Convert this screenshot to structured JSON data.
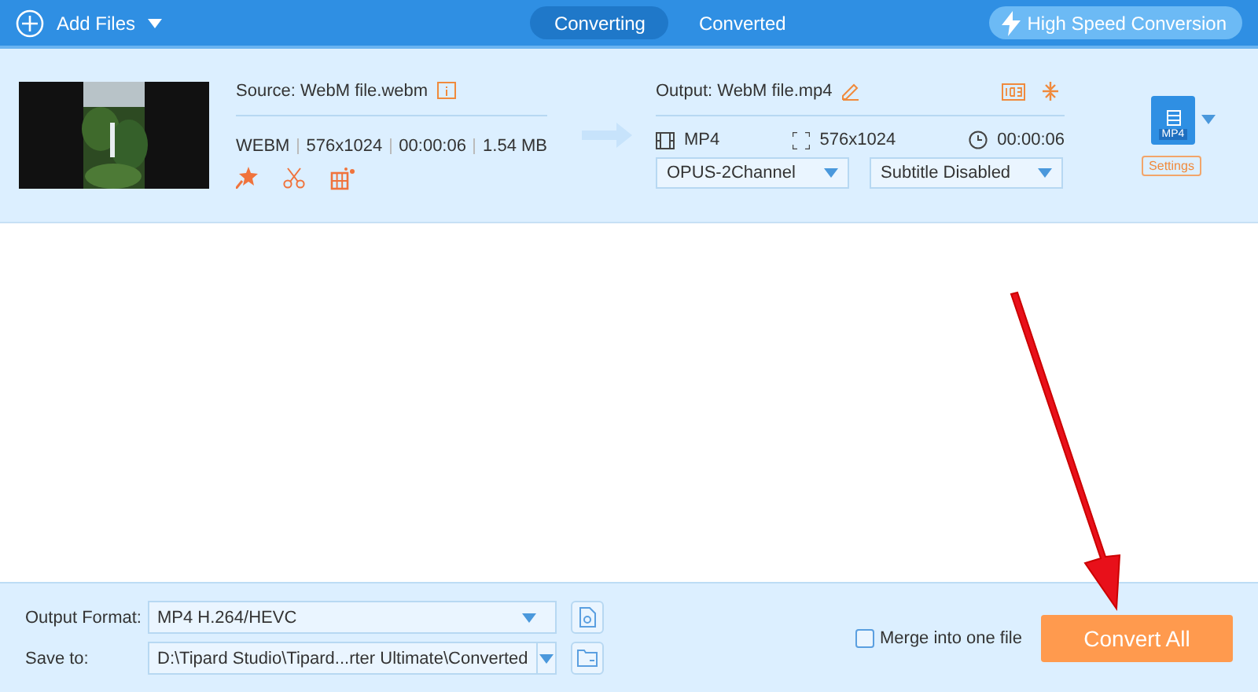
{
  "header": {
    "add_files": "Add Files",
    "tabs": [
      {
        "label": "Converting",
        "selected": true
      },
      {
        "label": "Converted",
        "selected": false
      }
    ],
    "high_speed": "High Speed Conversion"
  },
  "item": {
    "source": "Source: WebM file.webm",
    "source_info": [
      "WEBM",
      "576x1024",
      "00:00:06",
      "1.54 MB"
    ],
    "output": "Output: WebM file.mp4",
    "output_format": "MP4",
    "output_resolution": "576x1024",
    "output_duration": "00:00:06",
    "audio": "OPUS-2Channel",
    "subtitle": "Subtitle Disabled",
    "format_badge": "MP4",
    "settings": "Settings"
  },
  "footer": {
    "output_format_label": "Output Format:",
    "output_format": "MP4 H.264/HEVC",
    "save_to_label": "Save to:",
    "save_to": "D:\\Tipard Studio\\Tipard...rter Ultimate\\Converted",
    "merge": {
      "label": "Merge into one file",
      "checked": false
    },
    "convert": "Convert All"
  }
}
